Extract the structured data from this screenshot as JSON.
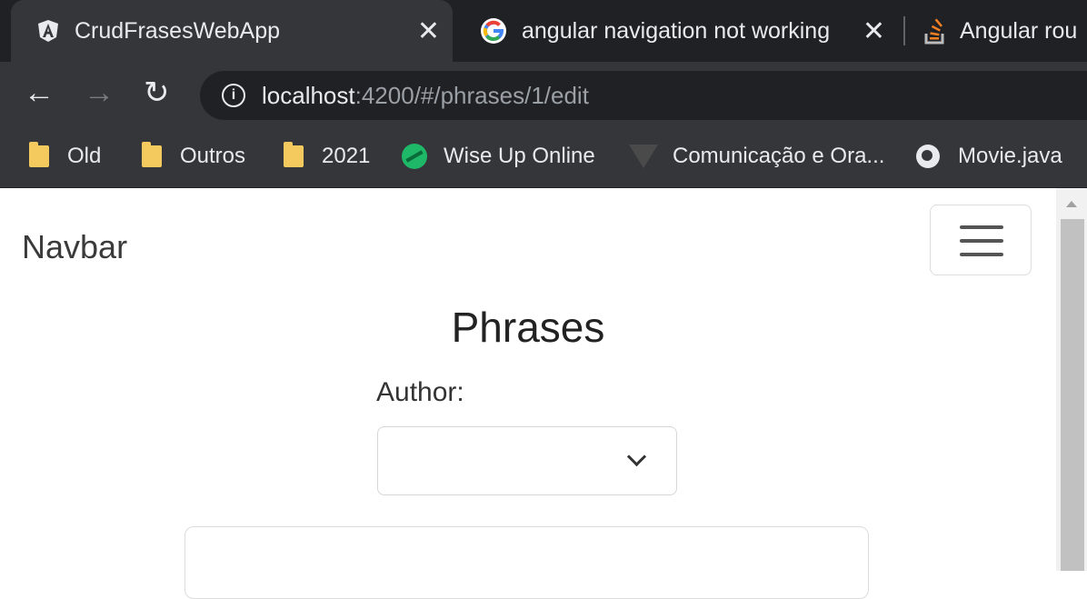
{
  "browser": {
    "tabs": [
      {
        "title": "CrudFrasesWebApp",
        "icon": "angular-icon",
        "active": true,
        "close": "✕"
      },
      {
        "title": "angular navigation not working w",
        "icon": "google-icon",
        "active": false,
        "close": "✕"
      },
      {
        "title": "Angular rou",
        "icon": "stackoverflow-icon",
        "active": false
      }
    ],
    "nav": {
      "back": "←",
      "forward": "→",
      "reload": "↻"
    },
    "address": {
      "host": "localhost",
      "path": ":4200/#/phrases/1/edit",
      "info": "i"
    },
    "bookmarks": [
      {
        "label": "Old",
        "icon": "folder-icon"
      },
      {
        "label": "Outros",
        "icon": "folder-icon"
      },
      {
        "label": "2021",
        "icon": "folder-icon"
      },
      {
        "label": "Wise Up Online",
        "icon": "wiseup-icon"
      },
      {
        "label": "Comunicação e Ora...",
        "icon": "triangle-icon"
      },
      {
        "label": "Movie.java",
        "icon": "globe-icon"
      }
    ]
  },
  "page": {
    "navbar": {
      "brand": "Navbar"
    },
    "heading": "Phrases",
    "form": {
      "author_label": "Author:",
      "author_value": ""
    }
  },
  "colors": {
    "tabstrip": "#202124",
    "chrome": "#35363a",
    "folder": "#f4c95d",
    "wiseup": "#1fb868"
  }
}
